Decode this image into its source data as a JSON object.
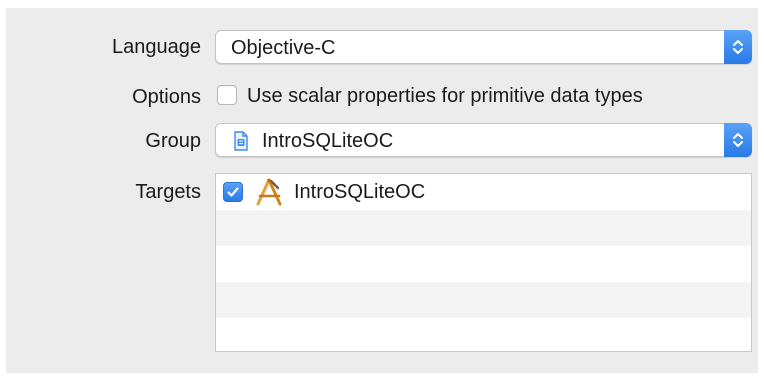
{
  "form": {
    "language": {
      "label": "Language",
      "value": "Objective-C"
    },
    "options": {
      "label": "Options",
      "checkbox_label": "Use scalar properties for primitive data types",
      "checked": false
    },
    "group": {
      "label": "Group",
      "value": "IntroSQLiteOC",
      "icon": "folder-document-icon"
    },
    "targets": {
      "label": "Targets",
      "items": [
        {
          "name": "IntroSQLiteOC",
          "checked": true,
          "icon": "xcode-app-icon"
        }
      ]
    }
  },
  "colors": {
    "accent": "#3a8bf0",
    "panel": "#ececec",
    "row_alt": "#f4f4f4"
  }
}
